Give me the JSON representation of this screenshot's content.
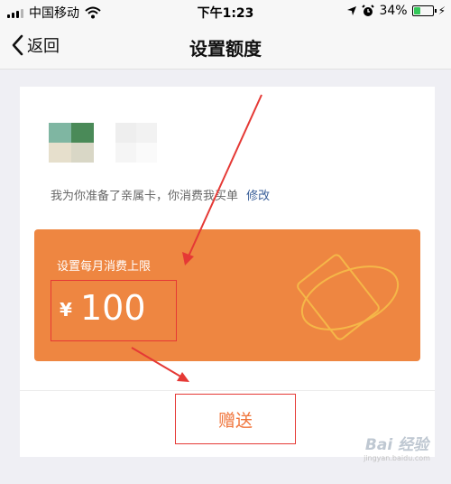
{
  "status_bar": {
    "carrier": "中国移动",
    "time": "下午1:23",
    "battery_percent": "34%",
    "battery_level": 0.34,
    "icons": [
      "signal-icon",
      "wifi-icon",
      "location-arrow-icon",
      "alarm-icon",
      "battery-icon",
      "charging-bolt-icon"
    ]
  },
  "nav": {
    "back_label": "返回",
    "title": "设置额度"
  },
  "card": {
    "message": "我为你准备了亲属卡，你消费我买单",
    "edit_label": "修改",
    "limit_label": "设置每月消费上限",
    "currency": "¥",
    "amount": "100",
    "gift_button_label": "赠送"
  },
  "colors": {
    "accent_orange": "#ee8641",
    "link_blue": "#3a5f99",
    "annotation_red": "#e53935",
    "gift_text": "#f0743a"
  },
  "watermark": {
    "logo_text": "Bai 经验",
    "url_text": "jingyan.baidu.com"
  }
}
